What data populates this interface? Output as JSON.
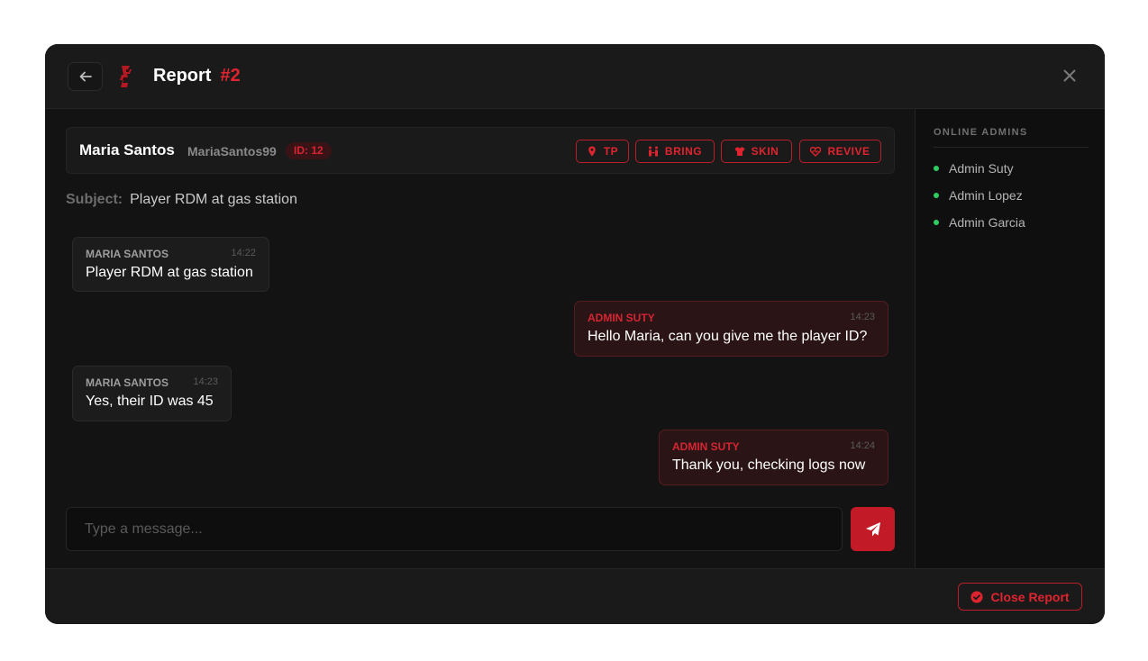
{
  "header": {
    "title": "Report",
    "number": "#2"
  },
  "player": {
    "name": "Maria Santos",
    "username": "MariaSantos99",
    "id_badge": "ID: 12",
    "actions": [
      {
        "label": "TP",
        "icon": "map-pin-icon"
      },
      {
        "label": "BRING",
        "icon": "people-arrows-icon"
      },
      {
        "label": "SKIN",
        "icon": "shirt-icon"
      },
      {
        "label": "REVIVE",
        "icon": "heart-pulse-icon"
      }
    ]
  },
  "subject": {
    "label": "Subject:",
    "text": "Player RDM at gas station"
  },
  "messages": [
    {
      "author": "MARIA SANTOS",
      "time": "14:22",
      "text": "Player RDM at gas station",
      "side": "player"
    },
    {
      "author": "ADMIN SUTY",
      "time": "14:23",
      "text": "Hello Maria, can you give me the player ID?",
      "side": "admin"
    },
    {
      "author": "MARIA SANTOS",
      "time": "14:23",
      "text": "Yes, their ID was 45",
      "side": "player"
    },
    {
      "author": "ADMIN SUTY",
      "time": "14:24",
      "text": "Thank you, checking logs now",
      "side": "admin"
    }
  ],
  "composer": {
    "placeholder": "Type a message...",
    "value": ""
  },
  "sidebar": {
    "title": "ONLINE ADMINS",
    "admins": [
      "Admin Suty",
      "Admin Lopez",
      "Admin Garcia"
    ]
  },
  "footer": {
    "close_label": "Close Report"
  },
  "colors": {
    "accent": "#e0242f",
    "online": "#2ecc62",
    "background": "#131313"
  }
}
